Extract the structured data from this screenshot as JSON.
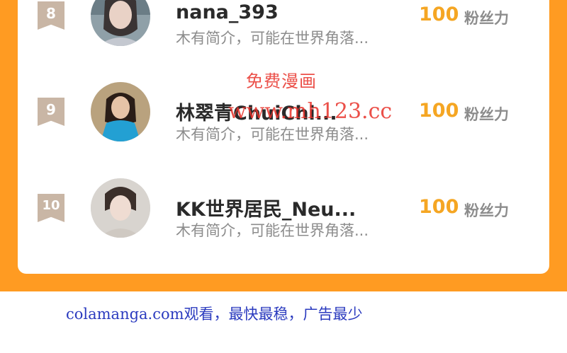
{
  "leaderboard": {
    "rows": [
      {
        "rank": "8",
        "name": "nana_393",
        "bio": "木有简介，可能在世界角落...",
        "count": "100",
        "unit": "粉丝力",
        "avatar": "user-avatar"
      },
      {
        "rank": "9",
        "name": "林翠青ChuiChi...",
        "bio": "木有简介，可能在世界角落...",
        "count": "100",
        "unit": "粉丝力",
        "avatar": "user-avatar"
      },
      {
        "rank": "10",
        "name": "KK世界居民_Neu...",
        "bio": "木有简介，可能在世界角落...",
        "count": "100",
        "unit": "粉丝力",
        "avatar": "user-avatar"
      }
    ]
  },
  "watermark": {
    "line1": "免费漫画",
    "line2": "www.mh123.cc"
  },
  "footer": {
    "text": "colamanga.com观看，最快最稳，广告最少"
  },
  "colors": {
    "frame": "#ff9b22",
    "count": "#f5a623",
    "rank_badge": "#c9b6a5",
    "watermark": "#e8322a",
    "footer": "#2b3bbf"
  }
}
